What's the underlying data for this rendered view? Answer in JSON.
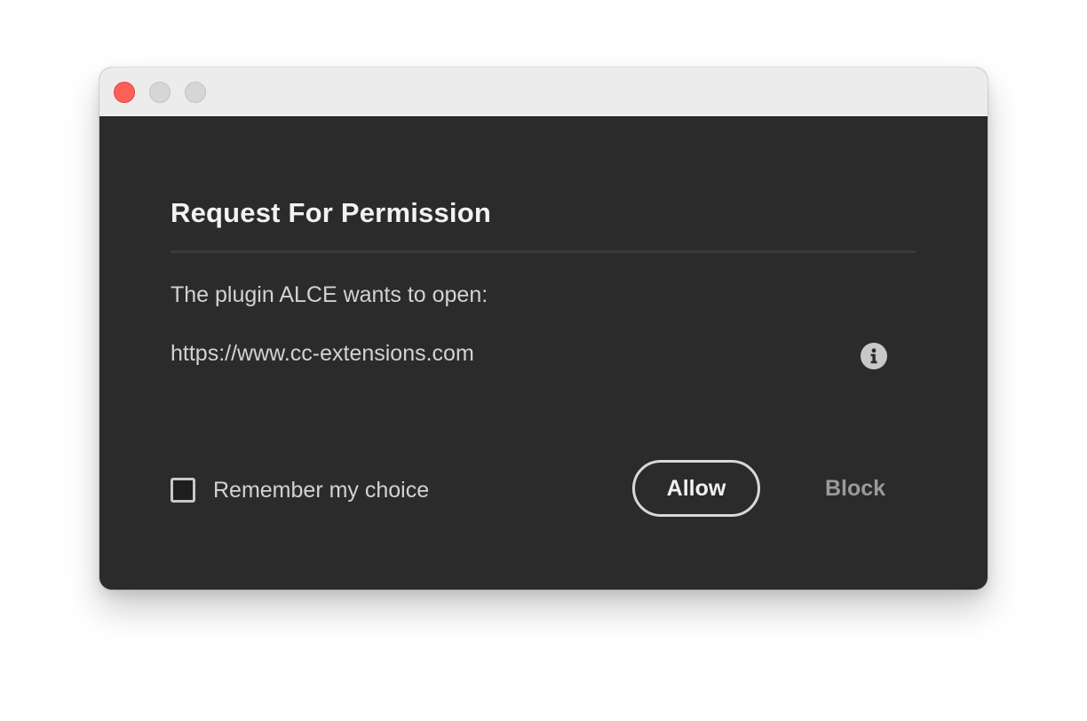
{
  "window": {
    "controls": {
      "close": "close-icon",
      "minimize": "minimize-icon",
      "maximize": "maximize-icon"
    }
  },
  "dialog": {
    "title": "Request For Permission",
    "prompt": "The plugin ALCE wants to open:",
    "url": "https://www.cc-extensions.com",
    "info_icon": "info-icon",
    "remember_label": "Remember my choice",
    "remember_checked": false,
    "allow_label": "Allow",
    "block_label": "Block"
  },
  "colors": {
    "dialog_background": "#2b2b2b",
    "titlebar_background": "#ececec",
    "close_button": "#fe5f57",
    "inactive_button": "#d6d6d6",
    "primary_text": "#f2f2f2",
    "secondary_text": "#d2d2d2",
    "muted_text": "#9a9a9a"
  }
}
